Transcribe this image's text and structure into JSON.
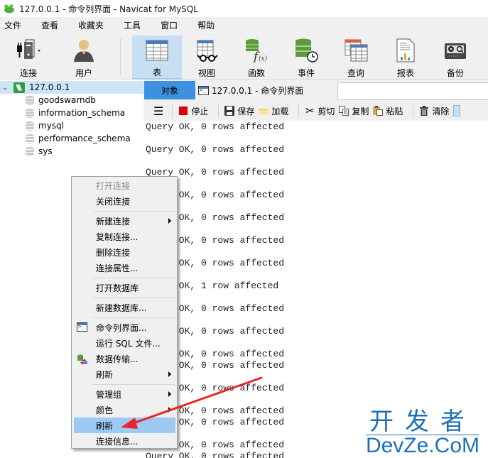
{
  "window": {
    "title": "127.0.0.1 - 命令列界面 - Navicat for MySQL"
  },
  "menubar": {
    "items": [
      "文件",
      "查看",
      "收藏夹",
      "工具",
      "窗口",
      "帮助"
    ]
  },
  "toolbar": {
    "items": [
      {
        "label": "连接",
        "icon": "plug-server-icon"
      },
      {
        "label": "用户",
        "icon": "user-icon"
      },
      {
        "label": "表",
        "icon": "table-icon",
        "active": true
      },
      {
        "label": "视图",
        "icon": "view-glasses-icon"
      },
      {
        "label": "函数",
        "icon": "function-icon"
      },
      {
        "label": "事件",
        "icon": "event-clock-icon"
      },
      {
        "label": "查询",
        "icon": "query-icon"
      },
      {
        "label": "报表",
        "icon": "report-icon"
      },
      {
        "label": "备份",
        "icon": "backup-cassette-icon"
      }
    ]
  },
  "sidebar": {
    "connection": "127.0.0.1",
    "databases": [
      "goodswarndb",
      "information_schema",
      "mysql",
      "performance_schema",
      "sys"
    ]
  },
  "tabs": {
    "objects": "对象",
    "console": "127.0.0.1 - 命令列界面"
  },
  "subtoolbar": {
    "stop": "停止",
    "save": "保存",
    "load": "加载",
    "cut": "剪切",
    "copy": "复制",
    "paste": "粘贴",
    "clear": "清除"
  },
  "output": {
    "lines": [
      "Query OK, 0 rows affected",
      "Query OK, 0 rows affected",
      "Query OK, 0 rows affected",
      "Query OK, 0 rows affected",
      "Query OK, 0 rows affected",
      "Query OK, 0 rows affected",
      "Query OK, 0 rows affected",
      "Query OK, 1 row affected",
      "Query OK, 0 rows affected",
      "Query OK, 0 rows affected",
      "Query OK, 0 rows affected",
      "Query OK, 0 rows affected",
      "Query OK, 0 rows affected",
      "Query OK, 0 rows affected",
      "Query OK, 0 rows affected",
      "Query OK, 0 rows affected",
      "Query OK, 0 rows affected"
    ]
  },
  "context_menu": {
    "items": [
      {
        "label": "打开连接",
        "disabled": true
      },
      {
        "label": "关闭连接"
      },
      {
        "label": "新建连接",
        "submenu": true
      },
      {
        "label": "复制连接..."
      },
      {
        "label": "删除连接"
      },
      {
        "label": "连接属性..."
      },
      {
        "label": "打开数据库"
      },
      {
        "label": "新建数据库..."
      },
      {
        "label": "命令列界面...",
        "icon": "console-icon"
      },
      {
        "label": "运行 SQL 文件..."
      },
      {
        "label": "数据传输...",
        "icon": "data-transfer-icon"
      },
      {
        "label": "刷新",
        "submenu": true
      },
      {
        "label": "管理组",
        "submenu": true
      },
      {
        "label": "颜色",
        "submenu": true
      },
      {
        "label": "刷新",
        "highlighted": true
      },
      {
        "label": "连接信息..."
      }
    ]
  },
  "annotation": {
    "arrow_color": "#e8262a",
    "target": "刷新"
  },
  "watermark": {
    "cn": "开发者",
    "en": "DevZe.CoM"
  },
  "colors": {
    "accent_tab": "#3d91df",
    "selection": "#cde4f7",
    "menu_highlight": "#9ccaf2"
  }
}
